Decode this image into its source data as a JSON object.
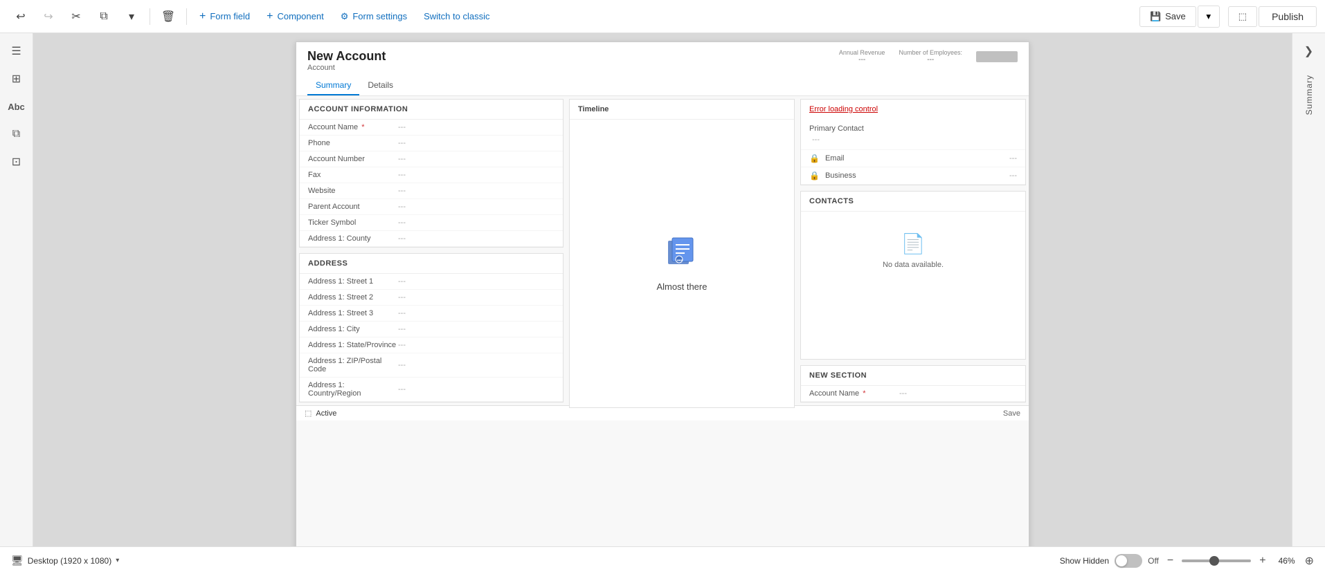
{
  "toolbar": {
    "undo_label": "↩",
    "redo_label": "↪",
    "cut_label": "✂",
    "copy_label": "⧉",
    "dropdown_label": "▾",
    "delete_label": "🗑",
    "form_field_label": "Form field",
    "component_label": "Component",
    "form_settings_label": "Form settings",
    "switch_classic_label": "Switch to classic",
    "save_label": "Save",
    "publish_label": "Publish"
  },
  "left_sidebar": {
    "icons": [
      "☰",
      "⊞",
      "Abc",
      "⧉",
      "⊡"
    ]
  },
  "right_panel": {
    "close_label": "❯",
    "section_label": "Summary"
  },
  "form": {
    "title": "New Account",
    "subtitle": "Account",
    "meta": [
      {
        "label": "Annual Revenue",
        "value": "---"
      },
      {
        "label": "Number of Employees:",
        "value": "---"
      }
    ],
    "tabs": [
      {
        "label": "Summary",
        "active": true
      },
      {
        "label": "Details",
        "active": false
      }
    ],
    "account_info_section": {
      "header": "ACCOUNT INFORMATION",
      "fields": [
        {
          "label": "Account Name",
          "required": true,
          "value": "---"
        },
        {
          "label": "Phone",
          "required": false,
          "value": "---"
        },
        {
          "label": "Account Number",
          "required": false,
          "value": "---"
        },
        {
          "label": "Fax",
          "required": false,
          "value": "---"
        },
        {
          "label": "Website",
          "required": false,
          "value": "---"
        },
        {
          "label": "Parent Account",
          "required": false,
          "value": "---"
        },
        {
          "label": "Ticker Symbol",
          "required": false,
          "value": "---"
        },
        {
          "label": "Address 1: County",
          "required": false,
          "value": "---"
        }
      ]
    },
    "address_section": {
      "header": "ADDRESS",
      "fields": [
        {
          "label": "Address 1: Street 1",
          "required": false,
          "value": "---"
        },
        {
          "label": "Address 1: Street 2",
          "required": false,
          "value": "---"
        },
        {
          "label": "Address 1: Street 3",
          "required": false,
          "value": "---"
        },
        {
          "label": "Address 1: City",
          "required": false,
          "value": "---"
        },
        {
          "label": "Address 1: State/Province",
          "required": false,
          "value": "---"
        },
        {
          "label": "Address 1: ZIP/Postal Code",
          "required": false,
          "value": "---"
        },
        {
          "label": "Address 1: Country/Region",
          "required": false,
          "value": "---"
        }
      ]
    },
    "timeline": {
      "header": "Timeline",
      "icon": "📁",
      "text": "Almost there"
    },
    "error_section": {
      "error_text": "Error loading control"
    },
    "primary_contact": {
      "label": "Primary Contact",
      "value": "---",
      "email_icon": "🔒",
      "email_label": "Email",
      "email_value": "---",
      "business_icon": "🔒",
      "business_label": "Business",
      "business_value": "---"
    },
    "contacts_section": {
      "header": "CONTACTS",
      "no_data_icon": "📄",
      "no_data_text": "No data available."
    },
    "new_section": {
      "header": "New Section",
      "fields": [
        {
          "label": "Account Name",
          "required": true,
          "value": "---"
        }
      ]
    },
    "status_bar": {
      "active_label": "Active",
      "save_label": "Save"
    }
  },
  "bottom_bar": {
    "desktop_label": "Desktop (1920 x 1080)",
    "show_hidden_label": "Show Hidden",
    "toggle_state": "Off",
    "zoom_percent": "46%"
  }
}
